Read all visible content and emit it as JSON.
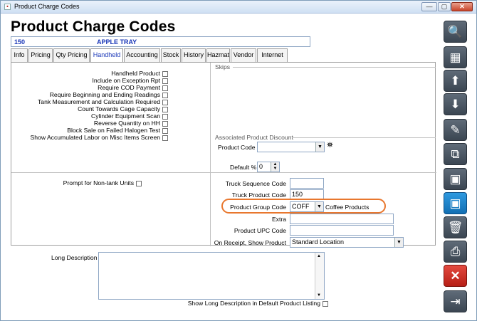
{
  "window": {
    "title": "Product Charge Codes",
    "minimize": "—",
    "restore": "▢",
    "close": "✕"
  },
  "header": {
    "title": "Product Charge Codes",
    "product_code": "150",
    "product_name": "APPLE TRAY"
  },
  "tabs": [
    "Info",
    "Pricing",
    "Qty Pricing",
    "Handheld",
    "Accounting",
    "Stock",
    "History",
    "Hazmat",
    "Vendor",
    "Internet"
  ],
  "active_tab": "Handheld",
  "handheld_options": [
    "Handheld Product",
    "Include on Exception Rpt",
    "Require COD Payment",
    "Require Beginning and Ending Readings",
    "Tank Measurement and Calculation Required",
    "Count Towards Cage Capacity",
    "Cylinder Equipment Scan",
    "Reverse Quantity on HH",
    "Block Sale on Failed Halogen Test",
    "Show Accumulated Labor on Misc Items Screen"
  ],
  "skips": {
    "label": "Skips"
  },
  "associated_discount": {
    "label": "Associated Product Discount",
    "product_code_label": "Product Code",
    "product_code_value": "",
    "default_pct_label": "Default %",
    "default_pct_value": "0"
  },
  "prompt_non_tank": "Prompt for Non-tank Units",
  "fields": {
    "truck_seq_label": "Truck Sequence Code",
    "truck_seq_value": "",
    "truck_product_label": "Truck Product Code",
    "truck_product_value": "150",
    "product_group_label": "Product Group Code",
    "product_group_value": "COFF",
    "product_group_desc": "Coffee Products",
    "extra_label": "Extra",
    "extra_value": "",
    "upc_label": "Product UPC Code",
    "upc_value": "",
    "on_receipt_label": "On Receipt, Show Product",
    "on_receipt_value": "Standard Location"
  },
  "long_description": {
    "label": "Long Description",
    "value": "",
    "show_label": "Show Long Description in Default Product Listing"
  },
  "sidebar": [
    {
      "name": "search-button",
      "icon": "search-icon",
      "glyph": "🔍"
    },
    {
      "name": "grid-button",
      "icon": "grid-icon",
      "glyph": "▦"
    },
    {
      "name": "up-button",
      "icon": "arrow-up-icon",
      "glyph": "⬆"
    },
    {
      "name": "down-button",
      "icon": "arrow-down-icon",
      "glyph": "⬇"
    },
    {
      "name": "edit-button",
      "icon": "pencil-icon",
      "glyph": "✎"
    },
    {
      "name": "copy-button",
      "icon": "copy-icon",
      "glyph": "⧉"
    },
    {
      "name": "new-button",
      "icon": "save-new-icon",
      "glyph": "▣"
    },
    {
      "name": "save-button",
      "icon": "save-icon",
      "glyph": "▣"
    },
    {
      "name": "delete-button",
      "icon": "trash-icon",
      "glyph": "🗑"
    },
    {
      "name": "print-button",
      "icon": "printer-icon",
      "glyph": "⎙"
    },
    {
      "name": "cancel-button",
      "icon": "close-icon",
      "glyph": "✕"
    },
    {
      "name": "exit-button",
      "icon": "exit-icon",
      "glyph": "⇥"
    }
  ]
}
